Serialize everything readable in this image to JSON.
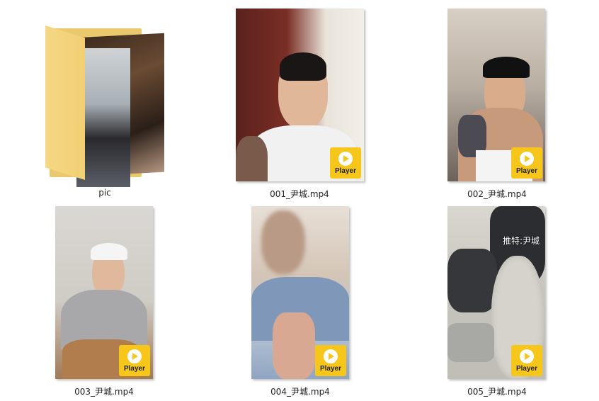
{
  "items": [
    {
      "name": "pic",
      "type": "folder"
    },
    {
      "name": "001_尹城.mp4",
      "type": "video",
      "badge": "Player"
    },
    {
      "name": "002_尹城.mp4",
      "type": "video",
      "badge": "Player"
    },
    {
      "name": "003_尹城.mp4",
      "type": "video",
      "badge": "Player"
    },
    {
      "name": "004_尹城.mp4",
      "type": "video",
      "badge": "Player"
    },
    {
      "name": "005_尹城.mp4",
      "type": "video",
      "badge": "Player",
      "overlay": "推特:尹城"
    }
  ],
  "colors": {
    "badge": "#f6c61a",
    "folder": "#f2cf73"
  },
  "icons": {
    "badge_icon": "play-icon",
    "folder_icon": "folder-icon"
  }
}
